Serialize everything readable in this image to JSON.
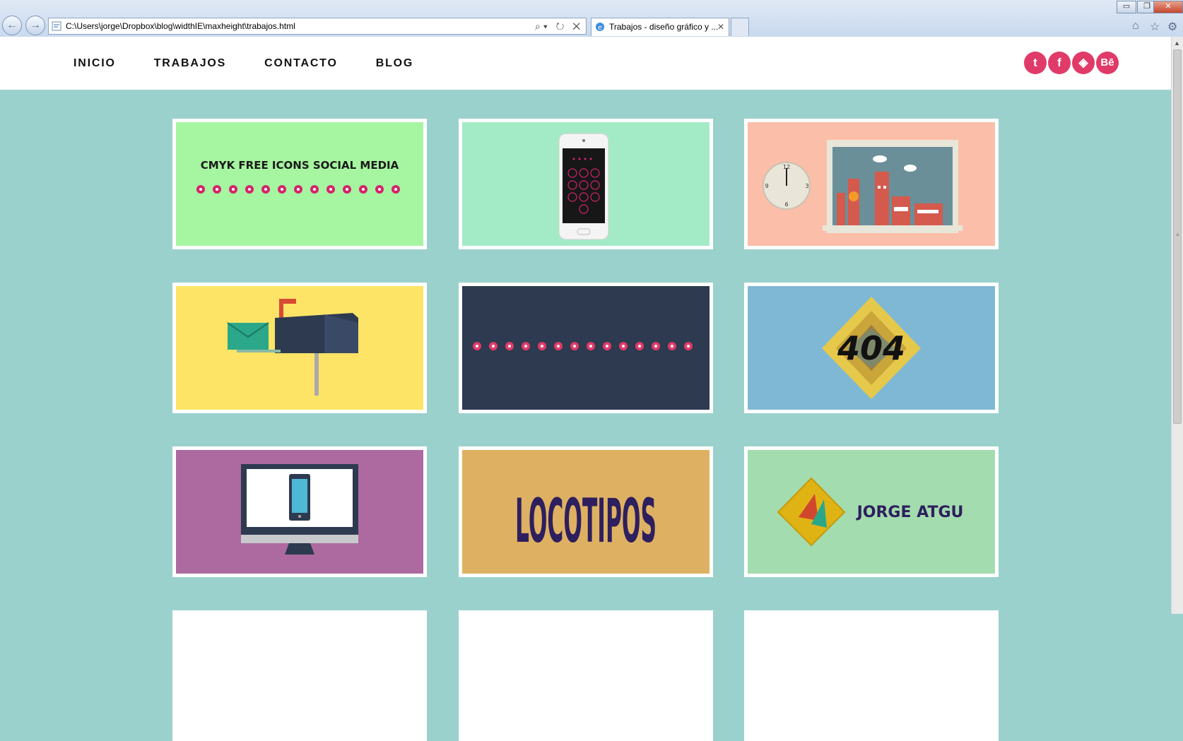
{
  "browser": {
    "address": "C:\\Users\\jorge\\Dropbox\\blog\\widthIE\\maxheight\\trabajos.html",
    "tab_title": "Trabajos - diseño gráfico y ...",
    "address_tools": "⌕▾ ↻ ✕",
    "tab_close": "✕",
    "back_icon": "←",
    "forward_icon": "→",
    "min_label": "▭",
    "restore_label": "❐",
    "close_label": "✕",
    "home_icon": "⌂",
    "fav_icon": "☆",
    "gear_icon": "⚙"
  },
  "nav": {
    "items": [
      "INICIO",
      "TRABAJOS",
      "CONTACTO",
      "BLOG"
    ]
  },
  "social": {
    "icons": [
      "twitter-icon",
      "facebook-icon",
      "codepen-icon",
      "behance-icon"
    ],
    "labels": [
      "t",
      "f",
      "◈",
      "Bē"
    ],
    "color": "#e03a69"
  },
  "works": {
    "cmyk_title": "CMYK FREE ICONS SOCIAL MEDIA",
    "logos_title": "LOCOTIPOS",
    "brand_name": "JORGE ATGU",
    "error_text": "404",
    "clock_numbers": [
      "12",
      "3",
      "6",
      "9"
    ],
    "colors": {
      "green": "#a6f5a0",
      "mint": "#a3ebc6",
      "peach": "#fbbea9",
      "yellow": "#fde466",
      "navy": "#2d3a50",
      "blue": "#7fb8d5",
      "purple": "#ad6aa0",
      "gold": "#deb162",
      "pale_green": "#a3dcae",
      "accent": "#e03a69"
    }
  }
}
